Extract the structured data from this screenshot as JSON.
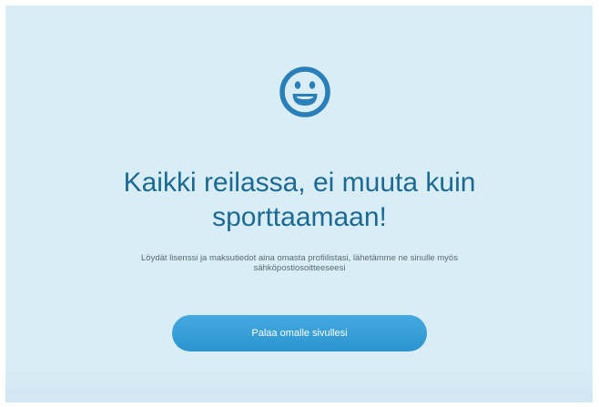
{
  "icon": "smiley-face-icon",
  "colors": {
    "background": "#d8edf6",
    "title": "#1c6a93",
    "button": "#2b95cf",
    "icon": "#2a7fb8"
  },
  "heading": {
    "line1": "Kaikki reilassa, ei muuta kuin",
    "line2": "sporttaamaan!"
  },
  "message": {
    "line1": "Löydät lisenssi ja maksutiedot aina omasta profiilistasi, lähetämme ne sinulle myös",
    "line2": "sähköpostiosoitteeseesi"
  },
  "button": {
    "label": "Palaa omalle sivullesi"
  }
}
